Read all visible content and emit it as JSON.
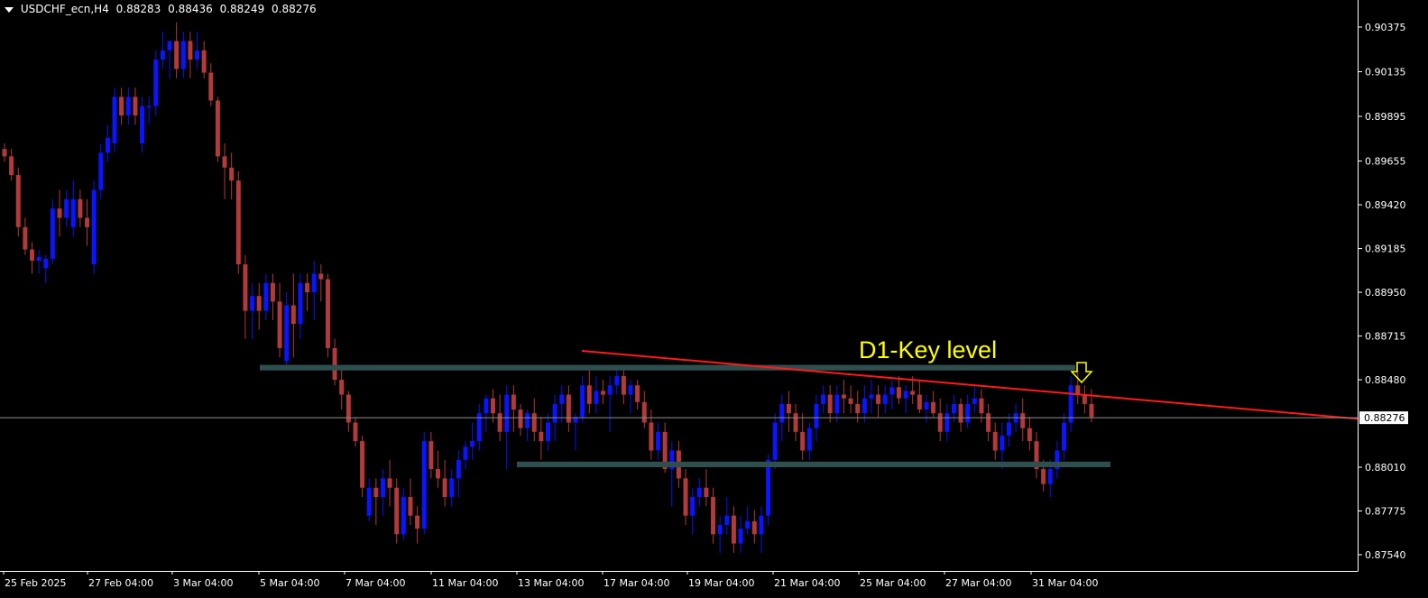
{
  "header": {
    "symbol": "USDCHF_ecn,H4",
    "open": "0.88283",
    "high": "0.88436",
    "low": "0.88249",
    "close": "0.88276"
  },
  "colors": {
    "background": "#000000",
    "bull": "#0a14ff",
    "bear": "#b23a3a",
    "zone": "#2f4f4f",
    "trendline": "#ff1a1a",
    "annotation": "#ffff00",
    "price_line": "#8f8f8f"
  },
  "chart_data": {
    "type": "candlestick",
    "price_axis": {
      "ticks": [
        0.90375,
        0.90135,
        0.89895,
        0.89655,
        0.8942,
        0.89185,
        0.8895,
        0.88715,
        0.8848,
        0.8801,
        0.87775,
        0.8754
      ],
      "tick_labels": [
        "0.90375",
        "0.90135",
        "0.89895",
        "0.89655",
        "0.89420",
        "0.89185",
        "0.88950",
        "0.88715",
        "0.88480",
        "0.88010",
        "0.87775",
        "0.87540"
      ],
      "current_price_label": "0.88276",
      "current_price": 0.88276
    },
    "time_axis": {
      "labels": [
        "25 Feb 2025",
        "27 Feb 04:00",
        "3 Mar 04:00",
        "5 Mar 04:00",
        "7 Mar 04:00",
        "11 Mar 04:00",
        "13 Mar 04:00",
        "17 Mar 04:00",
        "19 Mar 04:00",
        "21 Mar 04:00",
        "25 Mar 04:00",
        "27 Mar 04:00",
        "31 Mar 04:00"
      ]
    },
    "annotations": {
      "key_level_label": "D1-Key level",
      "resistance_zone": [
        0.8853,
        0.8856
      ],
      "support_zone": [
        0.8801,
        0.8804
      ],
      "trendline": [
        [
          0.88635,
          0.8827
        ]
      ]
    },
    "candles": [
      [
        0.8972,
        0.8975,
        0.8965,
        0.8968
      ],
      [
        0.8968,
        0.8972,
        0.8955,
        0.8958
      ],
      [
        0.8958,
        0.8962,
        0.8925,
        0.893
      ],
      [
        0.893,
        0.8935,
        0.8915,
        0.8918
      ],
      [
        0.8918,
        0.8922,
        0.8905,
        0.8912
      ],
      [
        0.8912,
        0.8918,
        0.8905,
        0.8914
      ],
      [
        0.8908,
        0.8915,
        0.89,
        0.8913
      ],
      [
        0.8913,
        0.8945,
        0.891,
        0.894
      ],
      [
        0.894,
        0.895,
        0.8925,
        0.8935
      ],
      [
        0.8935,
        0.895,
        0.893,
        0.8945
      ],
      [
        0.893,
        0.8955,
        0.8925,
        0.8945
      ],
      [
        0.8945,
        0.895,
        0.893,
        0.8935
      ],
      [
        0.8935,
        0.8945,
        0.892,
        0.893
      ],
      [
        0.891,
        0.8955,
        0.8905,
        0.895
      ],
      [
        0.895,
        0.8975,
        0.8945,
        0.897
      ],
      [
        0.897,
        0.8985,
        0.8965,
        0.8978
      ],
      [
        0.8975,
        0.9005,
        0.897,
        0.9
      ],
      [
        0.9,
        0.9005,
        0.8985,
        0.899
      ],
      [
        0.899,
        0.9005,
        0.8985,
        0.9
      ],
      [
        0.9,
        0.9005,
        0.8985,
        0.899
      ],
      [
        0.8975,
        0.9,
        0.897,
        0.8995
      ],
      [
        0.8995,
        0.9,
        0.8985,
        0.8995
      ],
      [
        0.8995,
        0.9025,
        0.899,
        0.902
      ],
      [
        0.902,
        0.9035,
        0.9015,
        0.9025
      ],
      [
        0.9025,
        0.903,
        0.901,
        0.903
      ],
      [
        0.903,
        0.904,
        0.901,
        0.9015
      ],
      [
        0.9015,
        0.9035,
        0.901,
        0.903
      ],
      [
        0.903,
        0.9035,
        0.901,
        0.902
      ],
      [
        0.902,
        0.9035,
        0.9015,
        0.9025
      ],
      [
        0.9025,
        0.903,
        0.901,
        0.9013
      ],
      [
        0.9013,
        0.9018,
        0.8995,
        0.8998
      ],
      [
        0.8998,
        0.9,
        0.8965,
        0.8968
      ],
      [
        0.8968,
        0.8975,
        0.8945,
        0.8962
      ],
      [
        0.8962,
        0.897,
        0.8945,
        0.8955
      ],
      [
        0.8955,
        0.896,
        0.8905,
        0.891
      ],
      [
        0.891,
        0.8915,
        0.887,
        0.8885
      ],
      [
        0.8885,
        0.89,
        0.887,
        0.8893
      ],
      [
        0.8893,
        0.89,
        0.8875,
        0.8885
      ],
      [
        0.8885,
        0.8905,
        0.888,
        0.89
      ],
      [
        0.89,
        0.8905,
        0.888,
        0.889
      ],
      [
        0.889,
        0.89,
        0.886,
        0.8865
      ],
      [
        0.8858,
        0.8895,
        0.8855,
        0.8888
      ],
      [
        0.8888,
        0.8905,
        0.886,
        0.8878
      ],
      [
        0.8878,
        0.8905,
        0.887,
        0.89
      ],
      [
        0.89,
        0.8905,
        0.8885,
        0.8895
      ],
      [
        0.8895,
        0.8912,
        0.888,
        0.8905
      ],
      [
        0.8905,
        0.891,
        0.889,
        0.8902
      ],
      [
        0.8902,
        0.8905,
        0.886,
        0.8865
      ],
      [
        0.8865,
        0.887,
        0.8845,
        0.8848
      ],
      [
        0.8848,
        0.8853,
        0.8832,
        0.884
      ],
      [
        0.884,
        0.8842,
        0.882,
        0.8825
      ],
      [
        0.8825,
        0.8828,
        0.8812,
        0.8815
      ],
      [
        0.8815,
        0.8818,
        0.8785,
        0.879
      ],
      [
        0.8775,
        0.8795,
        0.8772,
        0.879
      ],
      [
        0.879,
        0.8795,
        0.877,
        0.8785
      ],
      [
        0.8785,
        0.88,
        0.8775,
        0.8795
      ],
      [
        0.8795,
        0.8805,
        0.878,
        0.879
      ],
      [
        0.879,
        0.8795,
        0.876,
        0.8765
      ],
      [
        0.8765,
        0.879,
        0.8762,
        0.8785
      ],
      [
        0.8785,
        0.8795,
        0.877,
        0.8775
      ],
      [
        0.8775,
        0.878,
        0.876,
        0.8768
      ],
      [
        0.8768,
        0.882,
        0.8765,
        0.8815
      ],
      [
        0.8815,
        0.882,
        0.8795,
        0.88
      ],
      [
        0.88,
        0.881,
        0.879,
        0.8795
      ],
      [
        0.8795,
        0.8805,
        0.878,
        0.8785
      ],
      [
        0.8785,
        0.88,
        0.878,
        0.8795
      ],
      [
        0.8795,
        0.881,
        0.8785,
        0.8805
      ],
      [
        0.8805,
        0.8815,
        0.88,
        0.8812
      ],
      [
        0.8812,
        0.8825,
        0.8805,
        0.8815
      ],
      [
        0.8815,
        0.8835,
        0.881,
        0.883
      ],
      [
        0.883,
        0.884,
        0.882,
        0.8838
      ],
      [
        0.8838,
        0.8843,
        0.8825,
        0.883
      ],
      [
        0.883,
        0.884,
        0.8815,
        0.882
      ],
      [
        0.882,
        0.8845,
        0.88,
        0.884
      ],
      [
        0.884,
        0.8845,
        0.882,
        0.8832
      ],
      [
        0.8832,
        0.8835,
        0.8818,
        0.8822
      ],
      [
        0.8822,
        0.8832,
        0.8815,
        0.883
      ],
      [
        0.883,
        0.8838,
        0.8815,
        0.882
      ],
      [
        0.882,
        0.8828,
        0.8805,
        0.8815
      ],
      [
        0.8815,
        0.883,
        0.881,
        0.8825
      ],
      [
        0.8825,
        0.884,
        0.8815,
        0.8835
      ],
      [
        0.8835,
        0.8845,
        0.8825,
        0.884
      ],
      [
        0.884,
        0.8845,
        0.882,
        0.8825
      ],
      [
        0.8825,
        0.883,
        0.881,
        0.8828
      ],
      [
        0.8828,
        0.885,
        0.8825,
        0.8845
      ],
      [
        0.8845,
        0.8855,
        0.883,
        0.8835
      ],
      [
        0.8835,
        0.885,
        0.883,
        0.8842
      ],
      [
        0.8842,
        0.8848,
        0.8835,
        0.884
      ],
      [
        0.884,
        0.885,
        0.882,
        0.8845
      ],
      [
        0.8845,
        0.8855,
        0.884,
        0.885
      ],
      [
        0.885,
        0.8853,
        0.8835,
        0.884
      ],
      [
        0.884,
        0.8848,
        0.883,
        0.8845
      ],
      [
        0.8845,
        0.8848,
        0.8832,
        0.8836
      ],
      [
        0.8836,
        0.8842,
        0.8822,
        0.8825
      ],
      [
        0.8825,
        0.8832,
        0.8805,
        0.881
      ],
      [
        0.881,
        0.8825,
        0.8805,
        0.882
      ],
      [
        0.882,
        0.8825,
        0.8798,
        0.88
      ],
      [
        0.88,
        0.8815,
        0.878,
        0.881
      ],
      [
        0.881,
        0.8815,
        0.879,
        0.8795
      ],
      [
        0.8795,
        0.88,
        0.877,
        0.8775
      ],
      [
        0.8775,
        0.879,
        0.8765,
        0.8785
      ],
      [
        0.8785,
        0.8795,
        0.878,
        0.879
      ],
      [
        0.879,
        0.88,
        0.878,
        0.8785
      ],
      [
        0.8785,
        0.879,
        0.876,
        0.8765
      ],
      [
        0.8765,
        0.8775,
        0.8755,
        0.877
      ],
      [
        0.877,
        0.8785,
        0.8765,
        0.8775
      ],
      [
        0.8775,
        0.878,
        0.8755,
        0.876
      ],
      [
        0.876,
        0.8775,
        0.8755,
        0.8768
      ],
      [
        0.8768,
        0.878,
        0.8765,
        0.8772
      ],
      [
        0.8772,
        0.8778,
        0.876,
        0.8765
      ],
      [
        0.8765,
        0.878,
        0.8755,
        0.8775
      ],
      [
        0.8775,
        0.8808,
        0.877,
        0.8805
      ],
      [
        0.8805,
        0.883,
        0.88,
        0.8825
      ],
      [
        0.8825,
        0.884,
        0.8815,
        0.8835
      ],
      [
        0.8835,
        0.8842,
        0.882,
        0.883
      ],
      [
        0.883,
        0.8835,
        0.8815,
        0.882
      ],
      [
        0.882,
        0.883,
        0.8805,
        0.881
      ],
      [
        0.881,
        0.8825,
        0.8805,
        0.8822
      ],
      [
        0.8822,
        0.884,
        0.8815,
        0.8835
      ],
      [
        0.8835,
        0.8845,
        0.883,
        0.884
      ],
      [
        0.884,
        0.8845,
        0.8825,
        0.883
      ],
      [
        0.883,
        0.8845,
        0.8825,
        0.884
      ],
      [
        0.884,
        0.8848,
        0.883,
        0.8838
      ],
      [
        0.8838,
        0.8845,
        0.883,
        0.8835
      ],
      [
        0.8835,
        0.8842,
        0.8825,
        0.883
      ],
      [
        0.883,
        0.8845,
        0.8825,
        0.8838
      ],
      [
        0.8838,
        0.8848,
        0.883,
        0.884
      ],
      [
        0.884,
        0.8845,
        0.8828,
        0.8835
      ],
      [
        0.8835,
        0.8845,
        0.883,
        0.884
      ],
      [
        0.884,
        0.8848,
        0.8832,
        0.8844
      ],
      [
        0.8844,
        0.885,
        0.8835,
        0.8838
      ],
      [
        0.8838,
        0.8845,
        0.883,
        0.8842
      ],
      [
        0.8842,
        0.885,
        0.8835,
        0.884
      ],
      [
        0.884,
        0.8848,
        0.883,
        0.8832
      ],
      [
        0.8832,
        0.884,
        0.8825,
        0.8836
      ],
      [
        0.8836,
        0.8842,
        0.8828,
        0.883
      ],
      [
        0.883,
        0.8838,
        0.8815,
        0.882
      ],
      [
        0.882,
        0.8835,
        0.8815,
        0.883
      ],
      [
        0.883,
        0.884,
        0.8825,
        0.8835
      ],
      [
        0.8835,
        0.8838,
        0.882,
        0.8825
      ],
      [
        0.8825,
        0.884,
        0.8822,
        0.8835
      ],
      [
        0.8835,
        0.8845,
        0.883,
        0.8838
      ],
      [
        0.8838,
        0.8843,
        0.8825,
        0.883
      ],
      [
        0.883,
        0.8835,
        0.8815,
        0.882
      ],
      [
        0.882,
        0.8825,
        0.8805,
        0.881
      ],
      [
        0.881,
        0.8825,
        0.88,
        0.8818
      ],
      [
        0.8818,
        0.883,
        0.8812,
        0.8825
      ],
      [
        0.8825,
        0.8835,
        0.882,
        0.883
      ],
      [
        0.883,
        0.8838,
        0.8815,
        0.8822
      ],
      [
        0.8822,
        0.8828,
        0.881,
        0.8815
      ],
      [
        0.8815,
        0.882,
        0.8795,
        0.88
      ],
      [
        0.88,
        0.8805,
        0.8788,
        0.8792
      ],
      [
        0.8792,
        0.8805,
        0.8785,
        0.88
      ],
      [
        0.88,
        0.8815,
        0.8795,
        0.881
      ],
      [
        0.881,
        0.883,
        0.8805,
        0.8825
      ],
      [
        0.8825,
        0.885,
        0.882,
        0.8845
      ],
      [
        0.8845,
        0.8853,
        0.8835,
        0.884
      ],
      [
        0.884,
        0.8845,
        0.883,
        0.8835
      ],
      [
        0.8835,
        0.8843,
        0.8825,
        0.8828
      ]
    ]
  }
}
